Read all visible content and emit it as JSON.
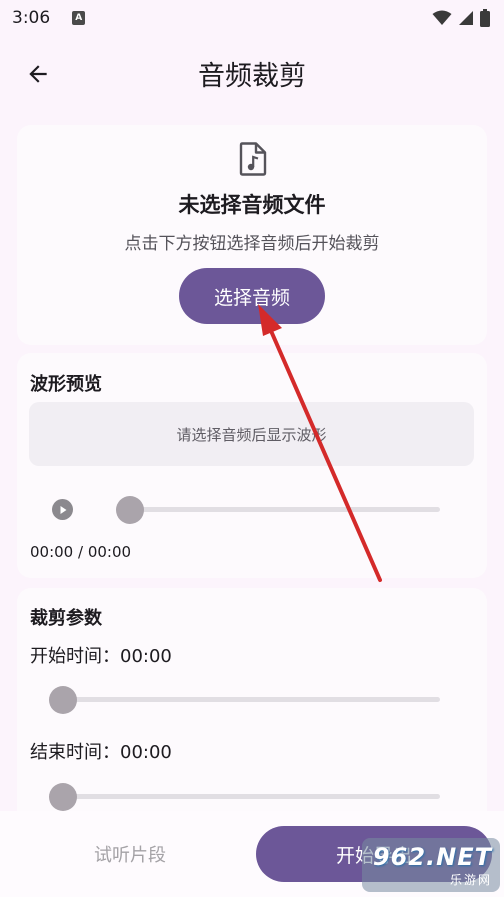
{
  "status_bar": {
    "time": "3:06",
    "notification_glyph": "A",
    "icons": [
      "wifi-icon",
      "signal-icon",
      "battery-icon"
    ]
  },
  "header": {
    "title": "音频裁剪",
    "back_icon": "arrow-left-icon"
  },
  "file_card": {
    "icon": "audio-file-icon",
    "heading": "未选择音频文件",
    "subtext": "点击下方按钮选择音频后开始裁剪",
    "select_button_label": "选择音频"
  },
  "waveform_card": {
    "title": "波形预览",
    "placeholder": "请选择音频后显示波形",
    "play_icon": "play-icon",
    "playback_position": 0,
    "time_readout": "00:00 / 00:00"
  },
  "params_card": {
    "title": "裁剪参数",
    "start_label": "开始时间：00:00",
    "start_position": 0,
    "end_label": "结束时间：00:00",
    "end_position": 0
  },
  "bottom_bar": {
    "preview_label": "试听片段",
    "export_label": "开始导出"
  },
  "watermark": {
    "logo": "962.NET",
    "sub": "乐游网"
  },
  "colors": {
    "accent": "#6c5798",
    "background": "#fcf4fc",
    "card": "#fdfafd",
    "annotation_arrow": "#d42a2a"
  }
}
